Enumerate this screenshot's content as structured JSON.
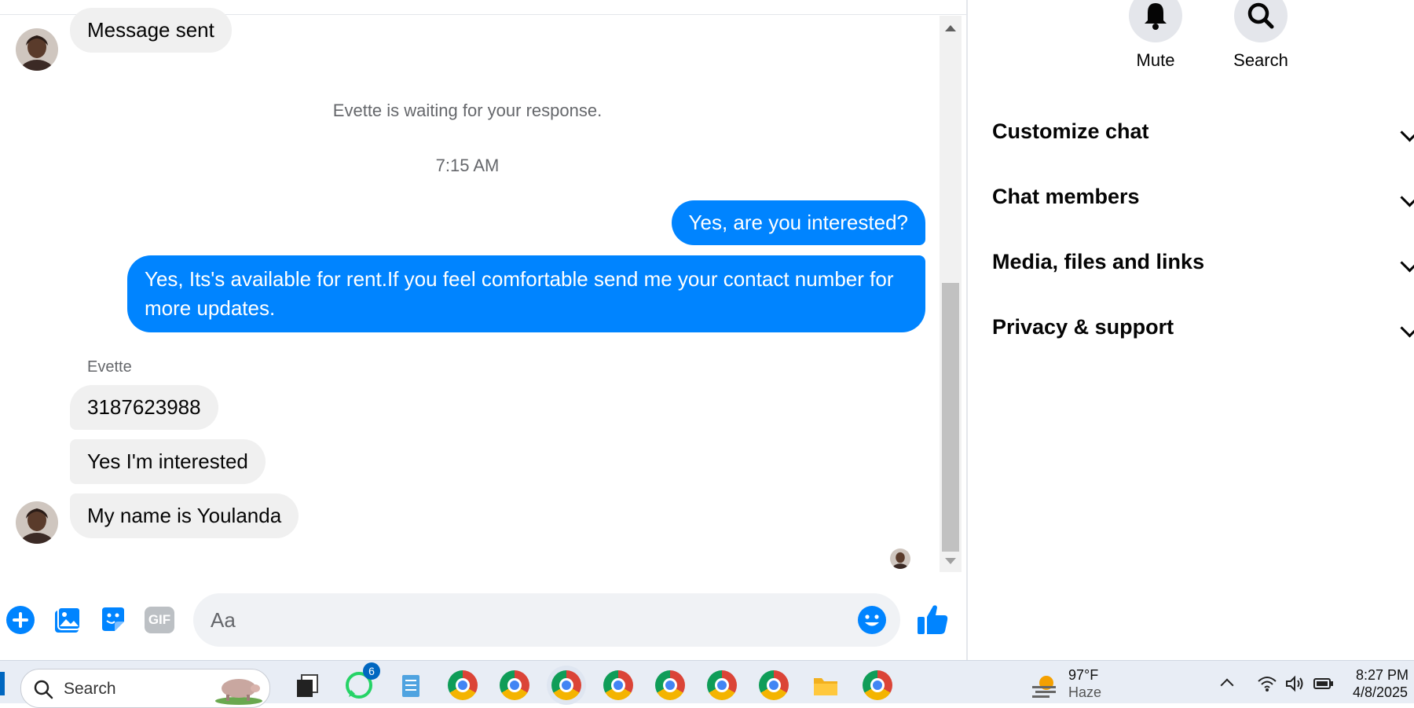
{
  "conversation": {
    "status_message": "Message sent",
    "waiting_notice": "Evette is waiting for your response.",
    "timestamp": "7:15 AM",
    "outgoing": [
      "Yes, are you interested?",
      "Yes, Its's available for rent.If you feel comfortable send me your contact number for more updates."
    ],
    "sender_name": "Evette",
    "incoming": [
      "3187623988",
      "Yes I'm interested",
      "My name is Youlanda"
    ]
  },
  "composer": {
    "placeholder": "Aa",
    "icons": [
      "plus-circle-icon",
      "photo-icon",
      "sticker-icon",
      "gif-icon",
      "emoji-icon",
      "thumbs-up-icon"
    ],
    "gif_label": "GIF"
  },
  "info_panel": {
    "actions": [
      {
        "label": "Mute",
        "icon": "bell-icon"
      },
      {
        "label": "Search",
        "icon": "search-icon"
      }
    ],
    "sections": [
      "Customize chat",
      "Chat members",
      "Media, files and links",
      "Privacy & support"
    ]
  },
  "taskbar": {
    "search_label": "Search",
    "whatsapp_badge": "6",
    "weather_temp": "97°F",
    "weather_condition": "Haze",
    "time": "8:27 PM",
    "date": "4/8/2025"
  },
  "colors": {
    "messenger_blue": "#0084ff",
    "incoming_bubble": "#f0f0f0",
    "panel_text": "#050505",
    "meta_text": "#65676b"
  }
}
